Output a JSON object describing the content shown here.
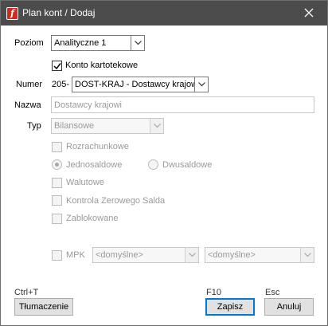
{
  "window": {
    "title": "Plan kont / Dodaj",
    "app_icon_letter": "f"
  },
  "form": {
    "poziom": {
      "label": "Poziom",
      "value": "Analityczne 1"
    },
    "konto_kartotekowe": {
      "label": "Konto kartotekowe",
      "checked": true
    },
    "numer": {
      "label": "Numer",
      "prefix": "205-",
      "value": "DOST-KRAJ - Dostawcy krajowi"
    },
    "nazwa": {
      "label": "Nazwa",
      "value": "Dostawcy krajowi"
    },
    "typ": {
      "label": "Typ",
      "value": "Bilansowe"
    },
    "rozrachunkowe": {
      "label": "Rozrachunkowe",
      "checked": false
    },
    "jednosaldowe": {
      "label": "Jednosaldowe",
      "selected": true
    },
    "dwusaldowe": {
      "label": "Dwusaldowe",
      "selected": false
    },
    "walutowe": {
      "label": "Walutowe",
      "checked": false
    },
    "kontrola": {
      "label": "Kontrola Zerowego Salda",
      "checked": false
    },
    "zablokowane": {
      "label": "Zablokowane",
      "checked": false
    },
    "mpk": {
      "label": "MPK",
      "checked": false,
      "combo1": "<domyślne>",
      "combo2": "<domyślne>"
    }
  },
  "footer": {
    "tlumaczenie": {
      "shortcut": "Ctrl+T",
      "label": "Tłumaczenie"
    },
    "zapisz": {
      "shortcut": "F10",
      "label": "Zapisz"
    },
    "anuluj": {
      "shortcut": "Esc",
      "label": "Anuluj"
    }
  },
  "colors": {
    "titlebar": "#4c4c4c",
    "app_icon": "#d42a1e",
    "primary_border": "#0078d7",
    "disabled_text": "#9a9a9a"
  }
}
